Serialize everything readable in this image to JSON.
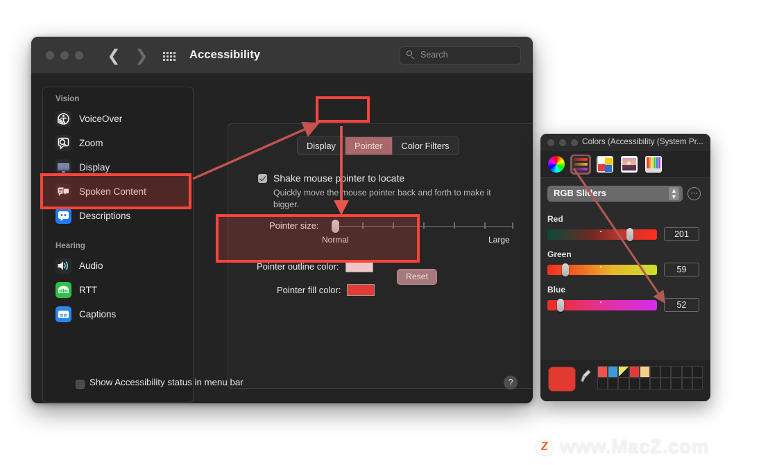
{
  "window": {
    "title": "Accessibility",
    "search_placeholder": "Search",
    "nav_back_icon": "chevron-left-icon",
    "nav_forward_icon": "chevron-right-icon",
    "grid_icon": "apps-grid-icon",
    "help_label": "?"
  },
  "sidebar": {
    "groups": [
      {
        "label": "Vision",
        "items": [
          {
            "label": "VoiceOver",
            "icon": "voiceover-icon",
            "selected": false
          },
          {
            "label": "Zoom",
            "icon": "zoom-icon",
            "selected": false
          },
          {
            "label": "Display",
            "icon": "display-icon",
            "selected": true
          },
          {
            "label": "Spoken Content",
            "icon": "spoken-content-icon",
            "selected": false
          },
          {
            "label": "Descriptions",
            "icon": "descriptions-icon",
            "selected": false
          }
        ]
      },
      {
        "label": "Hearing",
        "items": [
          {
            "label": "Audio",
            "icon": "audio-icon",
            "selected": false
          },
          {
            "label": "RTT",
            "icon": "rtt-icon",
            "selected": false
          },
          {
            "label": "Captions",
            "icon": "captions-icon",
            "selected": false
          }
        ]
      }
    ]
  },
  "content": {
    "tabs": [
      {
        "label": "Display",
        "selected": false
      },
      {
        "label": "Pointer",
        "selected": true
      },
      {
        "label": "Color Filters",
        "selected": false
      }
    ],
    "shake": {
      "label": "Shake mouse pointer to locate",
      "checked": true,
      "description": "Quickly move the mouse pointer back and forth to make it bigger."
    },
    "pointer_size": {
      "label": "Pointer size:",
      "min_label": "Normal",
      "max_label": "Large",
      "value_pct": 0
    },
    "outline_color": {
      "label": "Pointer outline color:",
      "value": "#f0c6c8"
    },
    "fill_color": {
      "label": "Pointer fill color:",
      "value": "#e23b33"
    },
    "reset_label": "Reset"
  },
  "bottom_bar": {
    "status_label": "Show Accessibility status in menu bar",
    "status_checked": false
  },
  "colors_panel": {
    "title": "Colors (Accessibility (System Pr...",
    "toolbar_icons": [
      {
        "name": "color-wheel-icon",
        "selected": false
      },
      {
        "name": "color-sliders-icon",
        "selected": true
      },
      {
        "name": "color-palettes-icon",
        "selected": false
      },
      {
        "name": "image-palettes-icon",
        "selected": false
      },
      {
        "name": "crayons-icon",
        "selected": false
      }
    ],
    "mode_select": {
      "value": "RGB Sliders"
    },
    "more_button_icon": "ellipsis-circle-icon",
    "sliders": [
      {
        "name": "Red",
        "value": "201",
        "pct": 79
      },
      {
        "name": "Green",
        "value": "59",
        "pct": 23
      },
      {
        "name": "Blue",
        "value": "52",
        "pct": 20
      }
    ],
    "current_color": "#e03a31",
    "eyedropper_icon": "eyedropper-icon",
    "swatches_row1": [
      "#ef5350",
      "#3a9ad9",
      "#e8e56a",
      "#e33b3b",
      "#f2cf8c",
      "#1f1f1f",
      "#1f1f1f",
      "#1f1f1f",
      "#1f1f1f",
      "#1f1f1f"
    ],
    "swatches_row2": [
      "#1f1f1f",
      "#1f1f1f",
      "#1f1f1f",
      "#1f1f1f",
      "#1f1f1f",
      "#1f1f1f",
      "#1f1f1f",
      "#1f1f1f",
      "#1f1f1f",
      "#1f1f1f"
    ]
  },
  "annotations": {
    "accent_color": "#f8453c",
    "boxes": [
      "display-sidebar-item",
      "pointer-tab",
      "pointer-colors-section"
    ],
    "arrows": [
      "display-to-pointer-tab",
      "pointer-tab-to-colors-section",
      "sliders-icon-to-blue-slider"
    ]
  },
  "watermark": {
    "badge_letter": "Z",
    "text": "www.MacZ.com"
  }
}
